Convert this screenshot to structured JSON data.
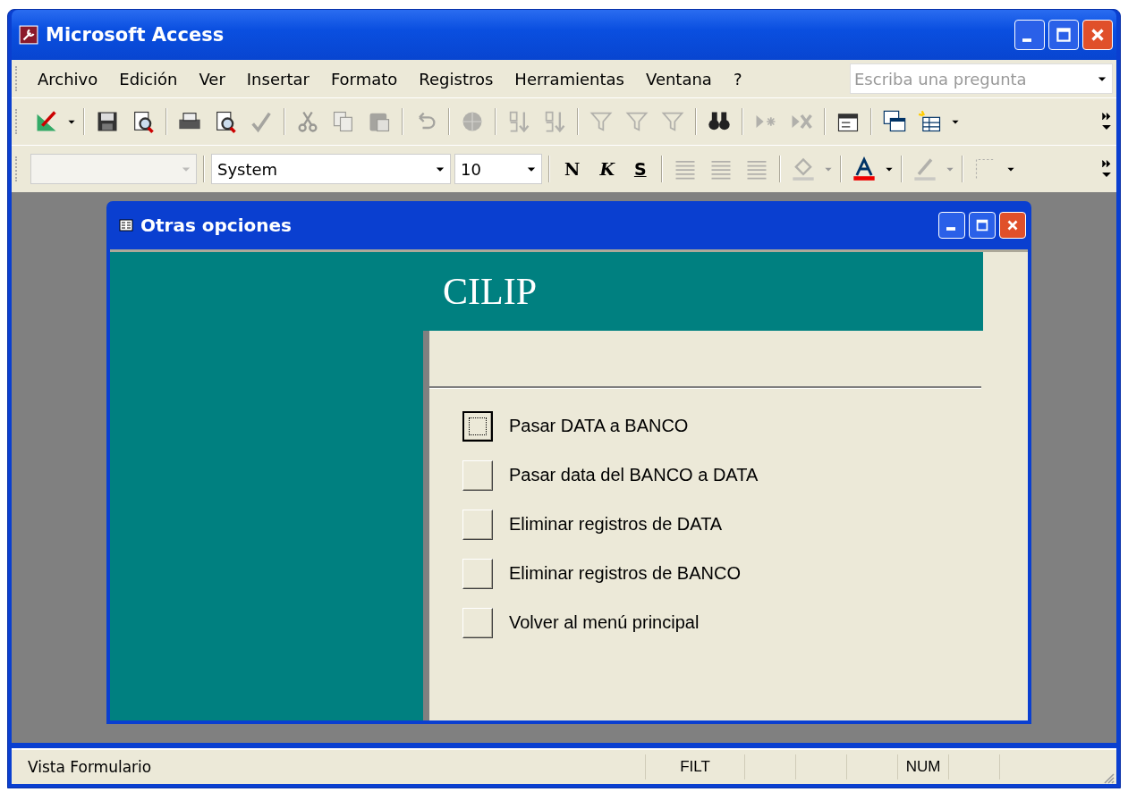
{
  "window": {
    "title": "Microsoft Access"
  },
  "menu": [
    "Archivo",
    "Edición",
    "Ver",
    "Insertar",
    "Formato",
    "Registros",
    "Herramientas",
    "Ventana",
    "?"
  ],
  "help_box": {
    "placeholder": "Escriba una pregunta"
  },
  "format_toolbar": {
    "object_box": {
      "disabled": true
    },
    "font_box": {
      "value": "System"
    },
    "size_box": {
      "value": "10"
    },
    "style_buttons": [
      {
        "label": "N",
        "kind": "bold"
      },
      {
        "label": "K",
        "kind": "italic"
      },
      {
        "label": "S",
        "kind": "underline"
      }
    ]
  },
  "form_window": {
    "title": "Otras opciones",
    "header": "CILIP",
    "options": [
      {
        "label": "Pasar DATA a BANCO",
        "focused": true
      },
      {
        "label": "Pasar data del BANCO a DATA",
        "focused": false
      },
      {
        "label": "Eliminar registros de DATA",
        "focused": false
      },
      {
        "label": "Eliminar registros de BANCO",
        "focused": false
      },
      {
        "label": "Volver al menú principal",
        "focused": false
      }
    ]
  },
  "status_bar": {
    "message": "Vista Formulario",
    "panels": [
      "FILT",
      "NUM"
    ]
  }
}
